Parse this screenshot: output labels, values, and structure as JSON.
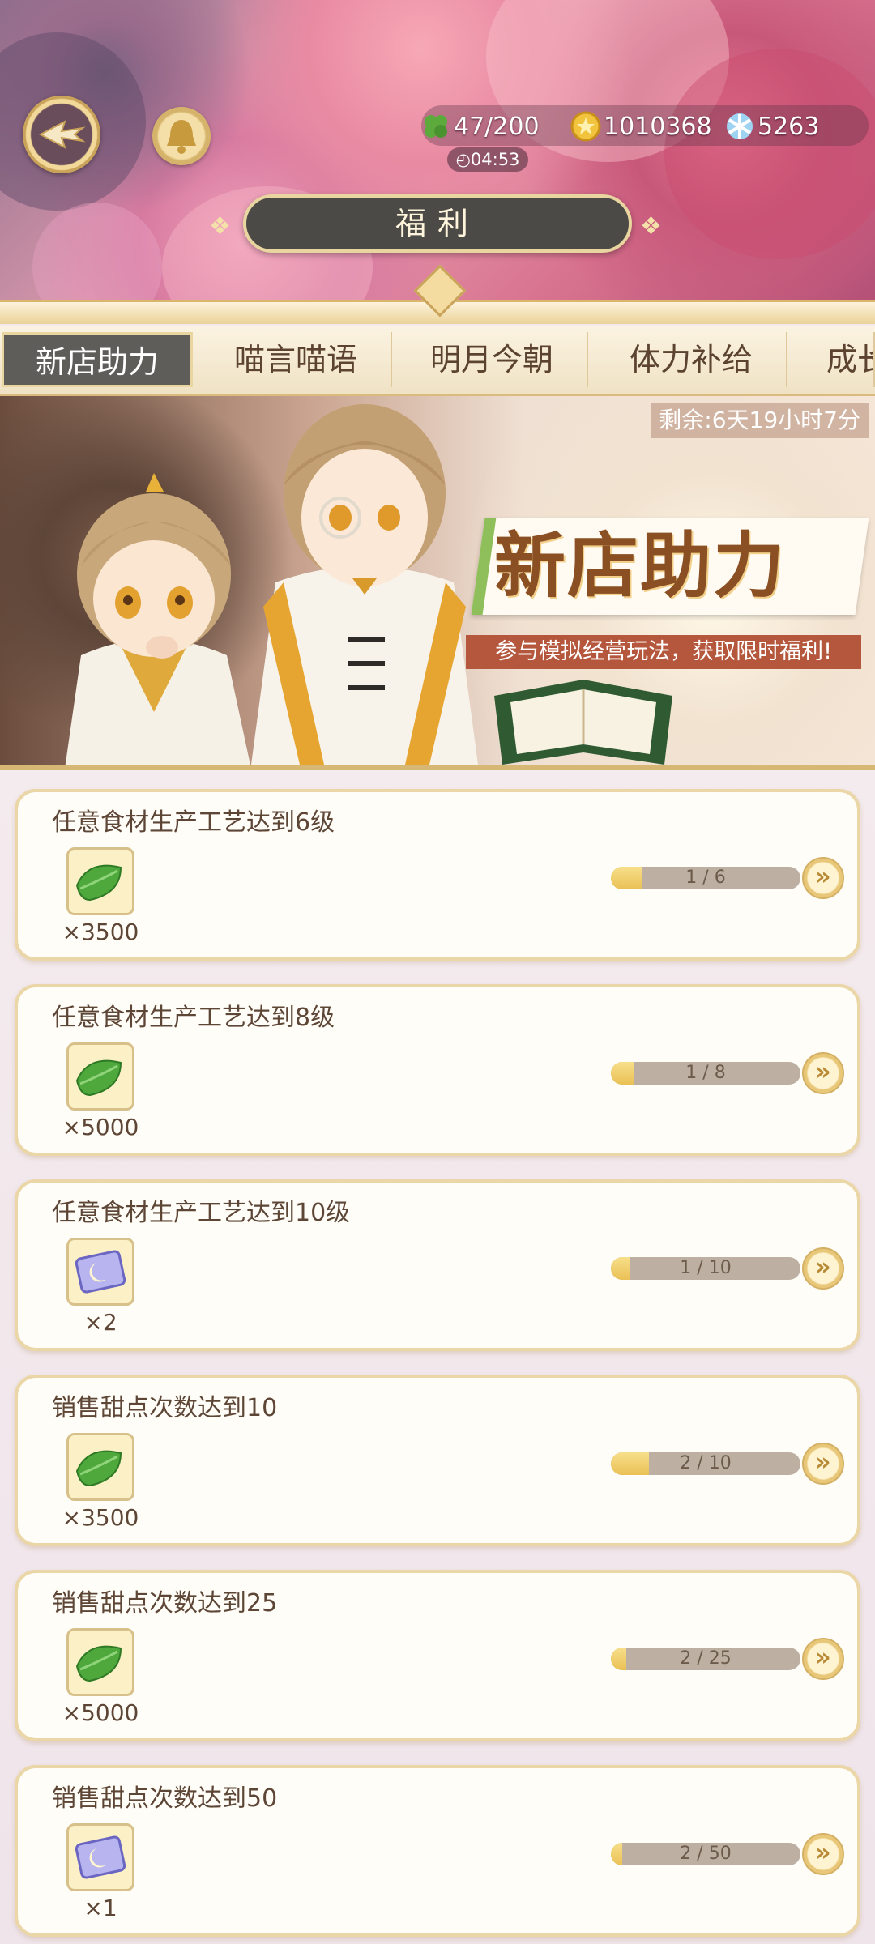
{
  "header": {
    "resources": {
      "stamina": "47/200",
      "coins": "1010368",
      "gems": "5263"
    },
    "timer": "04:53",
    "title": "福利"
  },
  "tabs": [
    {
      "label": "新店助力",
      "active": true
    },
    {
      "label": "喵言喵语",
      "active": false
    },
    {
      "label": "明月今朝",
      "active": false
    },
    {
      "label": "体力补给",
      "active": false
    },
    {
      "label": "成长",
      "active": false
    }
  ],
  "banner": {
    "remaining": "剩余:6天19小时7分",
    "title": "新店助力",
    "subtitle": "参与模拟经营玩法，获取限时福利!"
  },
  "tasks": [
    {
      "title": "任意食材生产工艺达到6级",
      "reward_icon": "leaf-icon",
      "quantity": "×3500",
      "progress": "1 / 6",
      "progress_value": 1,
      "progress_max": 6
    },
    {
      "title": "任意食材生产工艺达到8级",
      "reward_icon": "leaf-icon",
      "quantity": "×5000",
      "progress": "1 / 8",
      "progress_value": 1,
      "progress_max": 8
    },
    {
      "title": "任意食材生产工艺达到10级",
      "reward_icon": "ticket-icon",
      "quantity": "×2",
      "progress": "1 / 10",
      "progress_value": 1,
      "progress_max": 10
    },
    {
      "title": "销售甜点次数达到10",
      "reward_icon": "leaf-icon",
      "quantity": "×3500",
      "progress": "2 / 10",
      "progress_value": 2,
      "progress_max": 10
    },
    {
      "title": "销售甜点次数达到25",
      "reward_icon": "leaf-icon",
      "quantity": "×5000",
      "progress": "2 / 25",
      "progress_value": 2,
      "progress_max": 25
    },
    {
      "title": "销售甜点次数达到50",
      "reward_icon": "ticket-icon",
      "quantity": "×1",
      "progress": "2 / 50",
      "progress_value": 2,
      "progress_max": 50
    }
  ],
  "colors": {
    "accent_gold": "#e8d5a0",
    "active_tab": "#5f5d59",
    "banner_subtitle_bg": "#b4573c",
    "progress_fill": "#eac055"
  }
}
